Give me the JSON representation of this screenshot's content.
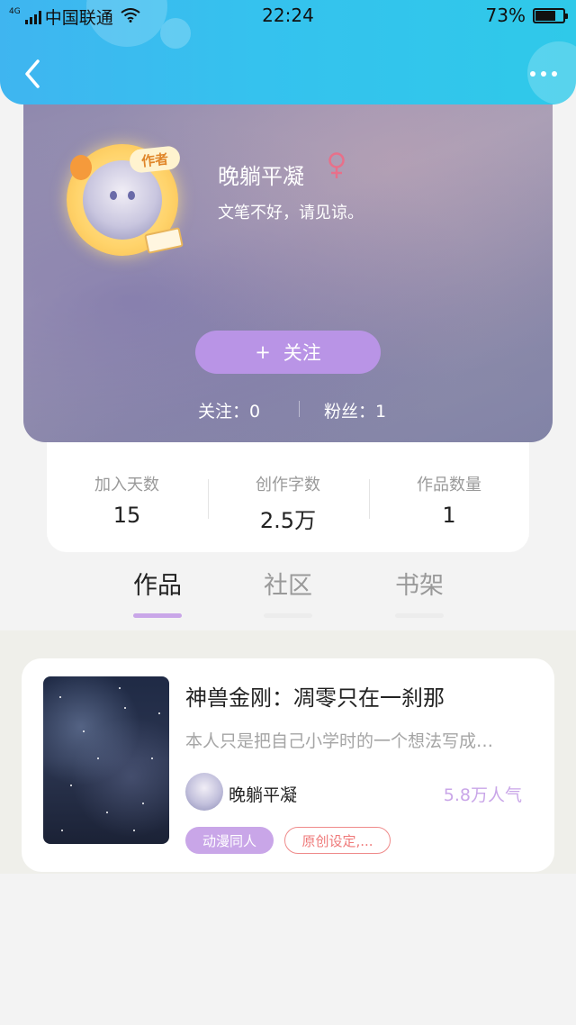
{
  "status_bar": {
    "network": "4G",
    "carrier": "中国联通",
    "time": "22:24",
    "battery_text": "73%",
    "battery_level": 0.73
  },
  "header": {
    "back_icon": "chevron-left-icon",
    "more_icon": "more-dots-icon"
  },
  "profile": {
    "name": "晚躺平凝",
    "gender_icon": "female-icon",
    "gender_color": "#e8708a",
    "bio": "文笔不好，请见谅。",
    "author_badge": "作者",
    "follow_plus": "+",
    "follow_label": "关注",
    "following_text": "关注：0",
    "fans_text": "粉丝：1"
  },
  "stats": [
    {
      "label": "加入天数",
      "value": "15"
    },
    {
      "label": "创作字数",
      "value": "2.5万"
    },
    {
      "label": "作品数量",
      "value": "1"
    }
  ],
  "tabs": [
    {
      "label": "作品",
      "active": true
    },
    {
      "label": "社区",
      "active": false
    },
    {
      "label": "书架",
      "active": false
    }
  ],
  "works": [
    {
      "title": "神兽金刚：凋零只在一刹那",
      "description": "本人只是把自己小学时的一个想法写成…",
      "author": "晚躺平凝",
      "popularity": "5.8万人气",
      "tags": [
        "动漫同人",
        "原创设定,..."
      ]
    }
  ],
  "colors": {
    "header_gradient_start": "#3fb5f0",
    "header_gradient_end": "#2fc9e9",
    "accent_purple": "#b994e6",
    "tag_purple": "#c9a6e8",
    "tag_red": "#ef7a7a"
  }
}
